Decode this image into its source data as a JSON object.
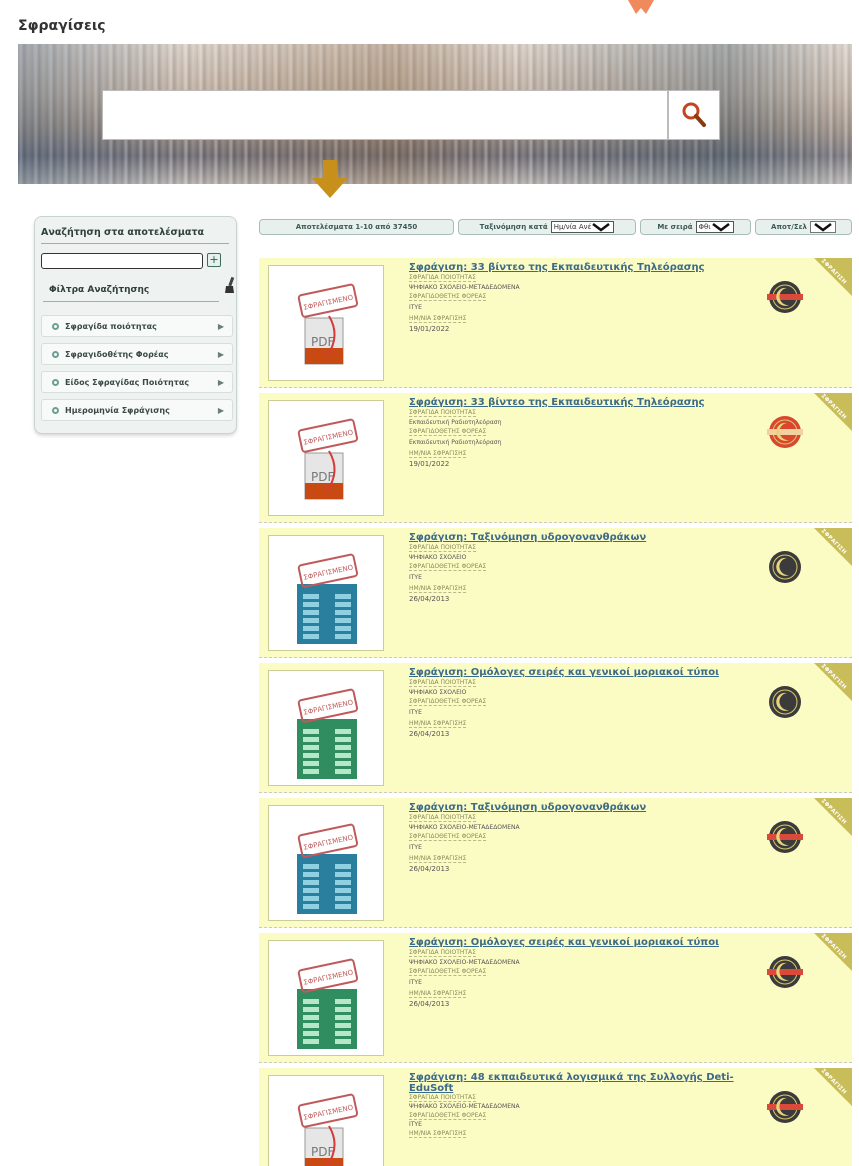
{
  "page_title": "Σφραγίσεις",
  "search": {
    "value": ""
  },
  "sidebar": {
    "title": "Αναζήτηση στα αποτελέσματα",
    "filters_title": "Φίλτρα Αναζήτησης",
    "items": [
      {
        "label": "Σφραγίδα ποιότητας"
      },
      {
        "label": "Σφραγιδοθέτης Φορέας"
      },
      {
        "label": "Είδος Σφραγίδας Ποιότητας"
      },
      {
        "label": "Ημερομηνία Σφράγισης"
      }
    ]
  },
  "toolbar": {
    "results_count": "Αποτελέσματα 1-10 από 37450",
    "sort_by_label": "Ταξινόμηση κατά",
    "sort_by_value": "Ημ/νία Ανέ",
    "order_label": "Με σειρά",
    "order_value": "Φθι",
    "per_page_label": "Αποτ/Σελ"
  },
  "results": [
    {
      "title": "Σφράγιση: 33 βίντεο της Εκπαιδευτικής Τηλεόρασης",
      "seal_label": "ΣΦΡΑΓΙΔΑ ΠΟΙΟΤΗΤΑΣ",
      "seal_value": "ΨΗΦΙΑΚΟ ΣΧΟΛΕΙΟ-ΜΕΤΑΔΕΔΟΜΕΝΑ",
      "agency_label": "ΣΦΡΑΓΙΔΟΘΕΤΗΣ ΦΟΡΕΑΣ",
      "agency_value": "ΙΤΥΕ",
      "date_label": "ΗΜ/ΝΙΑ ΣΦΡΑΓΙΣΗΣ",
      "date_value": "19/01/2022",
      "thumb": "pdf",
      "stamp": "ΣΦΡΑΓΙΣΜΕΝΟ",
      "badge": "dark-red",
      "corner": "ΣΦΡΑΓΙΣΗ"
    },
    {
      "title": "Σφράγιση: 33 βίντεο της Εκπαιδευτικής Τηλεόρασης",
      "seal_label": "ΣΦΡΑΓΙΔΑ ΠΟΙΟΤΗΤΑΣ",
      "seal_value": "Εκπαιδευτική Ραδιοτηλεόραση",
      "agency_label": "ΣΦΡΑΓΙΔΟΘΕΤΗΣ ΦΟΡΕΑΣ",
      "agency_value": "Εκπαιδευτική Ραδιοτηλεόραση",
      "date_label": "ΗΜ/ΝΙΑ ΣΦΡΑΓΙΣΗΣ",
      "date_value": "19/01/2022",
      "thumb": "pdf",
      "stamp": "ΣΦΡΑΓΙΣΜΕΝΟ",
      "badge": "red",
      "corner": "ΣΦΡΑΓΙΣΗ"
    },
    {
      "title": "Σφράγιση: Ταξινόμηση υδρογονανθράκων",
      "seal_label": "ΣΦΡΑΓΙΔΑ ΠΟΙΟΤΗΤΑΣ",
      "seal_value": "ΨΗΦΙΑΚΟ ΣΧΟΛΕΙΟ",
      "agency_label": "ΣΦΡΑΓΙΔΟΘΕΤΗΣ ΦΟΡΕΑΣ",
      "agency_value": "ΙΤΥΕ",
      "date_label": "ΗΜ/ΝΙΑ ΣΦΡΑΓΙΣΗΣ",
      "date_value": "26/04/2013",
      "thumb": "blue-table",
      "stamp": "ΣΦΡΑΓΙΣΜΕΝΟ",
      "badge": "dark",
      "corner": "ΣΦΡΑΓΙΣΗ"
    },
    {
      "title": "Σφράγιση: Ομόλογες σειρές και γενικοί μοριακοί τύποι",
      "seal_label": "ΣΦΡΑΓΙΔΑ ΠΟΙΟΤΗΤΑΣ",
      "seal_value": "ΨΗΦΙΑΚΟ ΣΧΟΛΕΙΟ",
      "agency_label": "ΣΦΡΑΓΙΔΟΘΕΤΗΣ ΦΟΡΕΑΣ",
      "agency_value": "ΙΤΥΕ",
      "date_label": "ΗΜ/ΝΙΑ ΣΦΡΑΓΙΣΗΣ",
      "date_value": "26/04/2013",
      "thumb": "green-table",
      "stamp": "ΣΦΡΑΓΙΣΜΕΝΟ",
      "badge": "dark",
      "corner": "ΣΦΡΑΓΙΣΗ"
    },
    {
      "title": "Σφράγιση: Ταξινόμηση υδρογονανθράκων",
      "seal_label": "ΣΦΡΑΓΙΔΑ ΠΟΙΟΤΗΤΑΣ",
      "seal_value": "ΨΗΦΙΑΚΟ ΣΧΟΛΕΙΟ-ΜΕΤΑΔΕΔΟΜΕΝΑ",
      "agency_label": "ΣΦΡΑΓΙΔΟΘΕΤΗΣ ΦΟΡΕΑΣ",
      "agency_value": "ΙΤΥΕ",
      "date_label": "ΗΜ/ΝΙΑ ΣΦΡΑΓΙΣΗΣ",
      "date_value": "26/04/2013",
      "thumb": "blue-table",
      "stamp": "ΣΦΡΑΓΙΣΜΕΝΟ",
      "badge": "dark-red",
      "corner": "ΣΦΡΑΓΙΣΗ"
    },
    {
      "title": "Σφράγιση: Ομόλογες σειρές και γενικοί μοριακοί τύποι",
      "seal_label": "ΣΦΡΑΓΙΔΑ ΠΟΙΟΤΗΤΑΣ",
      "seal_value": "ΨΗΦΙΑΚΟ ΣΧΟΛΕΙΟ-ΜΕΤΑΔΕΔΟΜΕΝΑ",
      "agency_label": "ΣΦΡΑΓΙΔΟΘΕΤΗΣ ΦΟΡΕΑΣ",
      "agency_value": "ΙΤΥΕ",
      "date_label": "ΗΜ/ΝΙΑ ΣΦΡΑΓΙΣΗΣ",
      "date_value": "26/04/2013",
      "thumb": "green-table",
      "stamp": "ΣΦΡΑΓΙΣΜΕΝΟ",
      "badge": "dark-red",
      "corner": "ΣΦΡΑΓΙΣΗ"
    },
    {
      "title": "Σφράγιση: 48 εκπαιδευτικά λογισμικά της Συλλογής Deti-EduSoft",
      "seal_label": "ΣΦΡΑΓΙΔΑ ΠΟΙΟΤΗΤΑΣ",
      "seal_value": "ΨΗΦΙΑΚΟ ΣΧΟΛΕΙΟ-ΜΕΤΑΔΕΔΟΜΕΝΑ",
      "agency_label": "ΣΦΡΑΓΙΔΟΘΕΤΗΣ ΦΟΡΕΑΣ",
      "agency_value": "ΙΤΥΕ",
      "date_label": "ΗΜ/ΝΙΑ ΣΦΡΑΓΙΣΗΣ",
      "date_value": "",
      "thumb": "pdf",
      "stamp": "ΣΦΡΑΓΙΣΜΕΝΟ",
      "badge": "dark-red",
      "corner": "ΣΦΡΑΓΙΣΗ"
    }
  ],
  "colors": {
    "accent": "#b8860b",
    "result_bg": "#fbfbc4",
    "link": "#3b6b8a"
  }
}
